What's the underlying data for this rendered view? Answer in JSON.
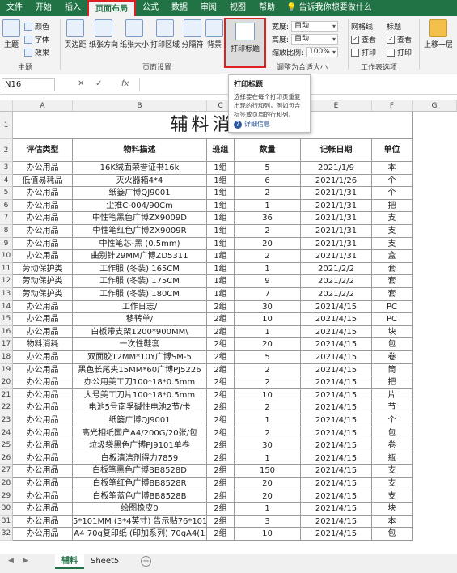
{
  "tabs": [
    "文件",
    "开始",
    "插入",
    "页面布局",
    "公式",
    "数据",
    "审阅",
    "视图",
    "帮助"
  ],
  "active_tab": "页面布局",
  "tell_me": "告诉我你想要做什么",
  "ribbon": {
    "theme": {
      "themes": "主题",
      "colors": "颜色",
      "fonts": "字体",
      "effects": "效果",
      "group": "主题"
    },
    "page_setup": {
      "margins": "页边距",
      "orientation": "纸张方向",
      "size": "纸张大小",
      "print_area": "打印区域",
      "breaks": "分隔符",
      "background": "背景",
      "print_titles": "打印标题",
      "group": "页面设置"
    },
    "scale": {
      "width_label": "宽度:",
      "width_value": "自动",
      "height_label": "高度:",
      "height_value": "自动",
      "scale_label": "缩放比例:",
      "scale_value": "100%",
      "group": "调整为合适大小"
    },
    "sheet_options": {
      "gridlines": "网格线",
      "headings": "标题",
      "view": "查看",
      "print": "打印",
      "group": "工作表选项"
    },
    "arrange": {
      "bring_forward": "上移一层"
    }
  },
  "formula_bar": {
    "name_box": "N16",
    "fx": "fx",
    "value": ""
  },
  "tooltip": {
    "title": "打印标题",
    "body": "选择要在每个打印页重复出现的行和列，例如包含标签或页眉的行和列。",
    "link": "详细信息"
  },
  "columns": [
    "A",
    "B",
    "C",
    "D",
    "E",
    "F",
    "G"
  ],
  "title": "辅料消耗",
  "headers": [
    "评估类型",
    "物料描述",
    "班组",
    "数量",
    "记帐日期",
    "单位"
  ],
  "rows": [
    [
      "办公用品",
      "16K绒面荣誉证书16k",
      "1组",
      "5",
      "2021/1/9",
      "本"
    ],
    [
      "低值易耗品",
      "灭火器箱4*4",
      "1组",
      "6",
      "2021/1/26",
      "个"
    ],
    [
      "办公用品",
      "纸篓广博QJ9001",
      "1组",
      "2",
      "2021/1/31",
      "个"
    ],
    [
      "办公用品",
      "尘推C-004/90Cm",
      "1组",
      "1",
      "2021/1/31",
      "把"
    ],
    [
      "办公用品",
      "中性笔黑色广博ZX9009D",
      "1组",
      "36",
      "2021/1/31",
      "支"
    ],
    [
      "办公用品",
      "中性笔红色广博ZX9009R",
      "1组",
      "2",
      "2021/1/31",
      "支"
    ],
    [
      "办公用品",
      "中性笔芯-黑 (0.5mm)",
      "1组",
      "20",
      "2021/1/31",
      "支"
    ],
    [
      "办公用品",
      "曲别针29MM广博ZD5311",
      "1组",
      "2",
      "2021/1/31",
      "盒"
    ],
    [
      "劳动保护类",
      "工作服 (冬装) 165CM",
      "1组",
      "1",
      "2021/2/2",
      "套"
    ],
    [
      "劳动保护类",
      "工作服 (冬装) 175CM",
      "1组",
      "9",
      "2021/2/2",
      "套"
    ],
    [
      "劳动保护类",
      "工作服 (冬装) 180CM",
      "1组",
      "7",
      "2021/2/2",
      "套"
    ],
    [
      "办公用品",
      "工作日志/",
      "2组",
      "30",
      "2021/4/15",
      "PC"
    ],
    [
      "办公用品",
      "移转单/",
      "2组",
      "10",
      "2021/4/15",
      "PC"
    ],
    [
      "办公用品",
      "白板带支架1200*900MM\\",
      "2组",
      "1",
      "2021/4/15",
      "块"
    ],
    [
      "物料消耗",
      "一次性鞋套",
      "2组",
      "20",
      "2021/4/15",
      "包"
    ],
    [
      "办公用品",
      "双面胶12MM*10Y广博SM-5",
      "2组",
      "5",
      "2021/4/15",
      "卷"
    ],
    [
      "办公用品",
      "黑色长尾夹15MM*60广博PJ5226",
      "2组",
      "2",
      "2021/4/15",
      "筒"
    ],
    [
      "办公用品",
      "办公用美工刀100*18*0.5mm",
      "2组",
      "2",
      "2021/4/15",
      "把"
    ],
    [
      "办公用品",
      "大号美工刀片100*18*0.5mm",
      "2组",
      "10",
      "2021/4/15",
      "片"
    ],
    [
      "办公用品",
      "电池5号南孚碱性电池2节/卡",
      "2组",
      "2",
      "2021/4/15",
      "节"
    ],
    [
      "办公用品",
      "纸篓广博QJ9001",
      "2组",
      "1",
      "2021/4/15",
      "个"
    ],
    [
      "办公用品",
      "高光相纸国产A4/200G/20张/包",
      "2组",
      "2",
      "2021/4/15",
      "包"
    ],
    [
      "办公用品",
      "垃圾袋黑色广博PJ9101单卷",
      "2组",
      "30",
      "2021/4/15",
      "卷"
    ],
    [
      "办公用品",
      "白板清洁剂得力7859",
      "2组",
      "1",
      "2021/4/15",
      "瓶"
    ],
    [
      "办公用品",
      "白板笔黑色广博BB8528D",
      "2组",
      "150",
      "2021/4/15",
      "支"
    ],
    [
      "办公用品",
      "白板笔红色广博BB8528R",
      "2组",
      "20",
      "2021/4/15",
      "支"
    ],
    [
      "办公用品",
      "白板笔蓝色广博BB8528B",
      "2组",
      "20",
      "2021/4/15",
      "支"
    ],
    [
      "办公用品",
      "绘图橡皮0",
      "2组",
      "1",
      "2021/4/15",
      "块"
    ],
    [
      "办公用品",
      "5*101MM (3*4英寸) 告示贴76*101M",
      "2组",
      "3",
      "2021/4/15",
      "本"
    ],
    [
      "办公用品",
      "A4 70g复印纸 (印加系列) 70gA4(1",
      "2组",
      "10",
      "2021/4/15",
      "包"
    ]
  ],
  "sheets": [
    "辅料",
    "Sheet5"
  ],
  "active_sheet": "辅料",
  "colors": {
    "excel_green": "#217346",
    "highlight_red": "#e02020",
    "link_blue": "#2b579a"
  }
}
